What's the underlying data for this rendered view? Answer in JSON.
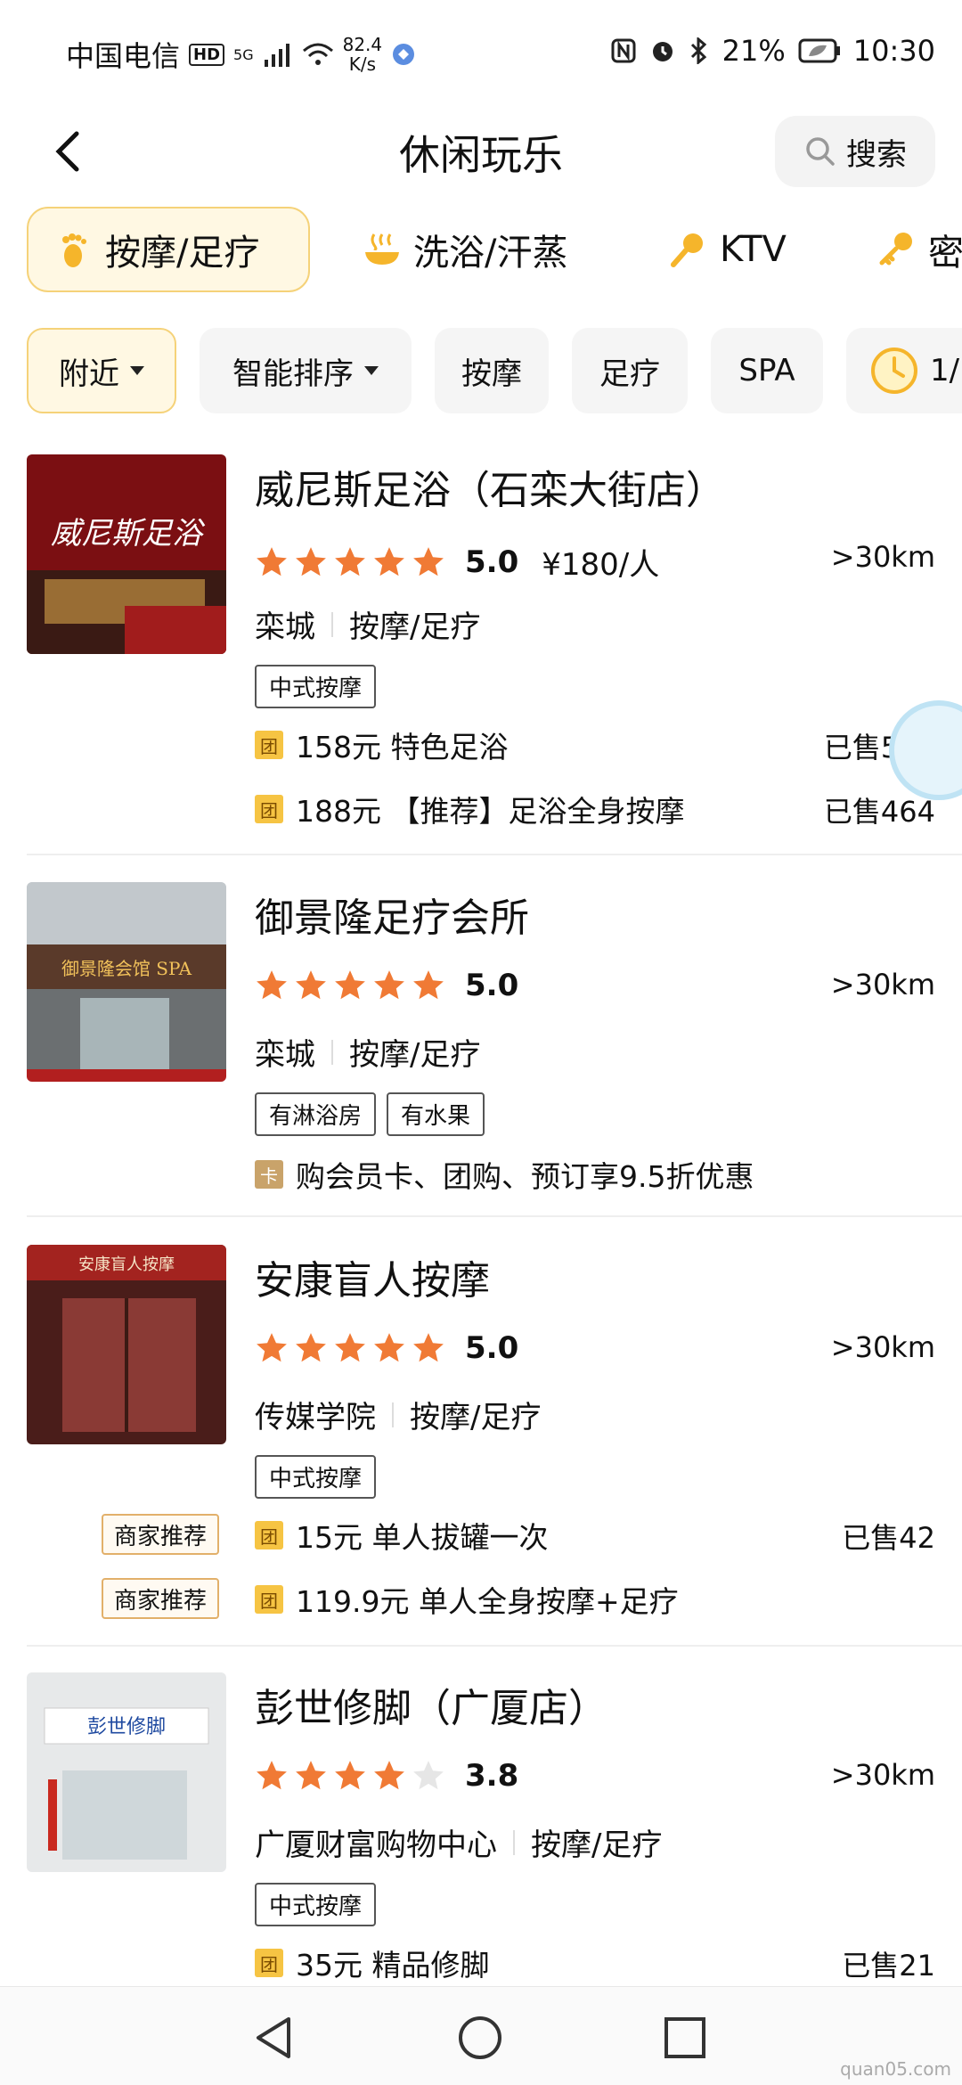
{
  "status": {
    "carrier": "中国电信",
    "hd": "HD",
    "net": "5G",
    "speed_value": "82.4",
    "speed_unit": "K/s",
    "battery": "21%",
    "time": "10:30"
  },
  "header": {
    "title": "休闲玩乐",
    "search_label": "搜索"
  },
  "categories": [
    {
      "label": "按摩/足疗",
      "icon": "foot-icon"
    },
    {
      "label": "洗浴/汗蒸",
      "icon": "bath-icon"
    },
    {
      "label": "KTV",
      "icon": "mic-icon"
    },
    {
      "label": "密",
      "icon": "key-icon"
    }
  ],
  "filters": [
    {
      "label": "附近"
    },
    {
      "label": "智能排序"
    },
    {
      "label": "按摩"
    },
    {
      "label": "足疗"
    },
    {
      "label": "SPA"
    },
    {
      "label": "1/"
    }
  ],
  "shops": [
    {
      "name": "威尼斯足浴（石栾大街店）",
      "thumb_text": "威尼斯足浴",
      "rating": 5.0,
      "score": "5.0",
      "price": "¥180/人",
      "distance": ">30km",
      "area": "栾城",
      "category": "按摩/足疗",
      "tags": [
        "中式按摩"
      ],
      "deals": [
        {
          "icon": "团",
          "text": "158元 特色足浴",
          "sold": "已售512"
        },
        {
          "icon": "团",
          "text": "188元 【推荐】足浴全身按摩",
          "sold": "已售464"
        }
      ]
    },
    {
      "name": "御景隆足疗会所",
      "thumb_text": "御景隆会馆 SPA",
      "rating": 5.0,
      "score": "5.0",
      "distance": ">30km",
      "area": "栾城",
      "category": "按摩/足疗",
      "tags": [
        "有淋浴房",
        "有水果"
      ],
      "card": {
        "icon": "卡",
        "text": "购会员卡、团购、预订享9.5折优惠"
      }
    },
    {
      "name": "安康盲人按摩",
      "thumb_text": "安康盲人按摩",
      "rating": 5.0,
      "score": "5.0",
      "distance": ">30km",
      "area": "传媒学院",
      "category": "按摩/足疗",
      "tags": [
        "中式按摩"
      ],
      "deals": [
        {
          "badge": "商家推荐",
          "icon": "团",
          "text": "15元 单人拔罐一次",
          "sold": "已售42"
        },
        {
          "badge": "商家推荐",
          "icon": "团",
          "text": "119.9元 单人全身按摩+足疗",
          "sold": ""
        }
      ]
    },
    {
      "name": "彭世修脚（广厦店）",
      "thumb_text": "彭世修脚",
      "rating": 3.8,
      "score": "3.8",
      "distance": ">30km",
      "area": "广厦财富购物中心",
      "category": "按摩/足疗",
      "tags": [
        "中式按摩"
      ],
      "deals": [
        {
          "icon": "团",
          "text": "35元 精品修脚",
          "sold": "已售21"
        }
      ]
    }
  ],
  "watermark": "quan05.com",
  "colors": {
    "accent": "#f5c443",
    "star": "#f07a35",
    "star_empty": "#e6e6e6"
  }
}
